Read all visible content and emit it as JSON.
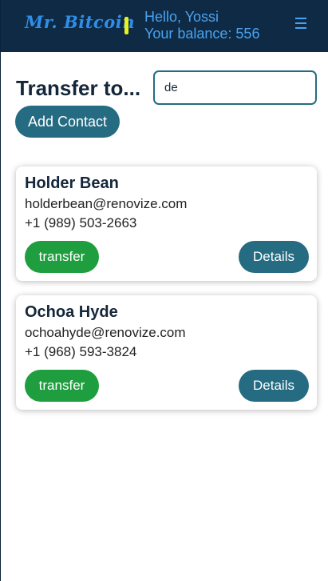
{
  "header": {
    "logo": "Mr. Bitcoin",
    "greeting": "Hello, Yossi",
    "balance_text": "Your balance: 556",
    "menu_icon": "hamburger-menu-icon"
  },
  "transfer": {
    "title": "Transfer to...",
    "search_value": "de",
    "add_contact_label": "Add Contact"
  },
  "contacts": [
    {
      "name": "Holder Bean",
      "email": "holderbean@renovize.com",
      "phone": "+1 (989) 503-2663",
      "transfer_label": "transfer",
      "details_label": "Details"
    },
    {
      "name": "Ochoa Hyde",
      "email": "ochoahyde@renovize.com",
      "phone": "+1 (968) 593-3824",
      "transfer_label": "transfer",
      "details_label": "Details"
    }
  ],
  "colors": {
    "header_bg": "#0e2a45",
    "logo": "#2f8ee8",
    "accent_yellow": "#eaf21d",
    "primary": "#256b82",
    "transfer_green": "#1f9e3f"
  }
}
